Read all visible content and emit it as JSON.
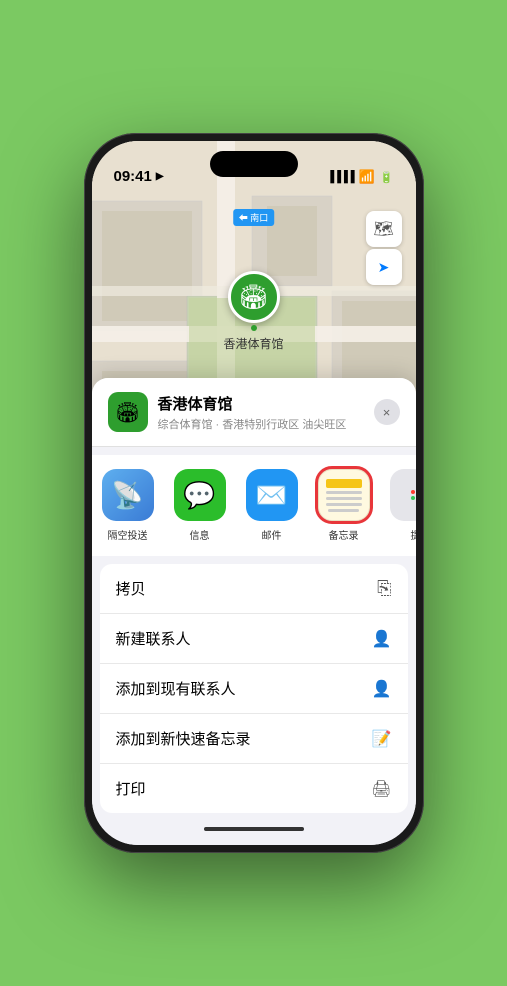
{
  "status": {
    "time": "09:41",
    "location_arrow": "▶",
    "signal": "●●●●",
    "wifi": "wifi",
    "battery": "battery"
  },
  "map": {
    "label": "南口",
    "label_prefix": "⬅",
    "pin_name": "香港体育馆",
    "controls": {
      "layers": "🗺",
      "location": "➤"
    }
  },
  "location_card": {
    "name": "香港体育馆",
    "subtitle": "综合体育馆 · 香港特别行政区 油尖旺区",
    "close_label": "×"
  },
  "share_items": [
    {
      "id": "airdrop",
      "label": "隔空投送"
    },
    {
      "id": "messages",
      "label": "信息"
    },
    {
      "id": "mail",
      "label": "邮件"
    },
    {
      "id": "notes",
      "label": "备忘录"
    },
    {
      "id": "more",
      "label": "提"
    }
  ],
  "actions": [
    {
      "label": "拷贝",
      "icon": "📋"
    },
    {
      "label": "新建联系人",
      "icon": "👤"
    },
    {
      "label": "添加到现有联系人",
      "icon": "👤"
    },
    {
      "label": "添加到新快速备忘录",
      "icon": "📝"
    },
    {
      "label": "打印",
      "icon": "🖨"
    }
  ],
  "home_indicator": "─"
}
